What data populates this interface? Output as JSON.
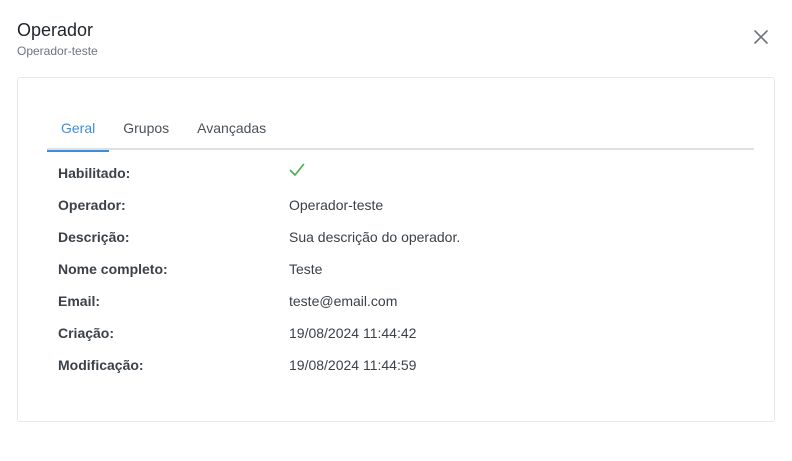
{
  "header": {
    "title": "Operador",
    "subtitle": "Operador-teste"
  },
  "tabs": [
    {
      "label": "Geral",
      "active": true
    },
    {
      "label": "Grupos",
      "active": false
    },
    {
      "label": "Avançadas",
      "active": false
    }
  ],
  "details": {
    "enabled": {
      "label": "Habilitado:",
      "value": true,
      "icon": "check-icon"
    },
    "operator": {
      "label": "Operador:",
      "value": "Operador-teste"
    },
    "description": {
      "label": "Descrição:",
      "value": "Sua descrição do operador."
    },
    "full_name": {
      "label": "Nome completo:",
      "value": "Teste"
    },
    "email": {
      "label": "Email:",
      "value": "teste@email.com"
    },
    "created": {
      "label": "Criação:",
      "value": "19/08/2024 11:44:42"
    },
    "modified": {
      "label": "Modificação:",
      "value": "19/08/2024 11:44:59"
    }
  },
  "colors": {
    "accent": "#3d8fd9",
    "check": "#4caf50"
  },
  "icons": {
    "close": "close-icon"
  }
}
